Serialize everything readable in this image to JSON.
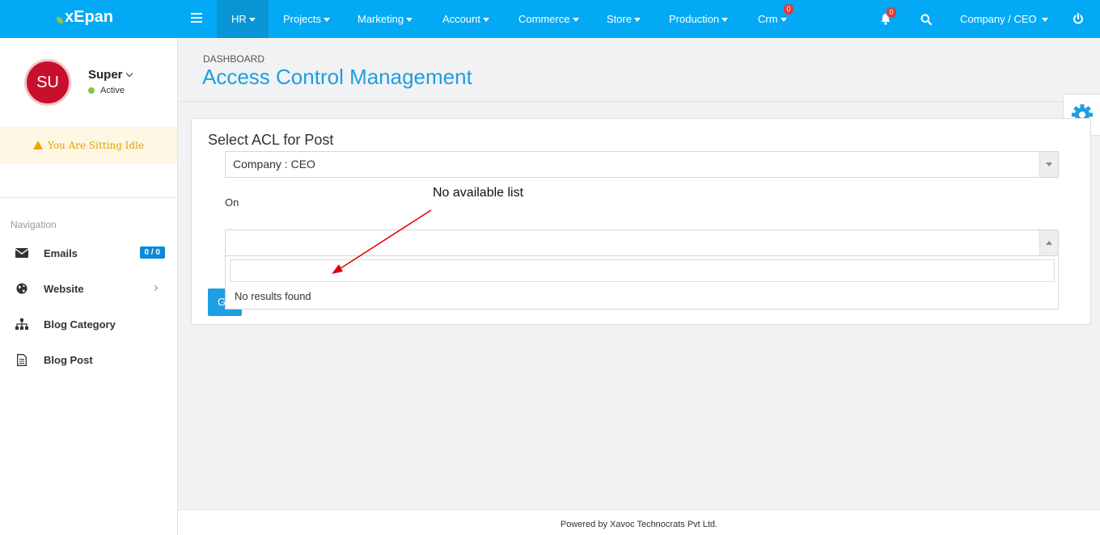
{
  "app": {
    "logo": "xEpan"
  },
  "topnav": {
    "items": [
      {
        "label": "HR"
      },
      {
        "label": "Projects"
      },
      {
        "label": "Marketing"
      },
      {
        "label": "Account"
      },
      {
        "label": "Commerce"
      },
      {
        "label": "Store"
      },
      {
        "label": "Production"
      },
      {
        "label": "Crm",
        "badge": "0"
      }
    ],
    "notifications_badge": "0",
    "user_menu": "Company / CEO"
  },
  "sidebar": {
    "avatar_initials": "SU",
    "user_name": "Super",
    "user_status": "Active",
    "idle_message": "You Are Sitting Idle",
    "nav_heading": "Navigation",
    "items": [
      {
        "label": "Emails",
        "icon": "envelope-icon",
        "count": "0 / 0"
      },
      {
        "label": "Website",
        "icon": "globe-icon"
      },
      {
        "label": "Blog Category",
        "icon": "sitemap-icon"
      },
      {
        "label": "Blog Post",
        "icon": "file-icon"
      }
    ]
  },
  "header": {
    "breadcrumb": "DASHBOARD",
    "title": "Access Control Management"
  },
  "form": {
    "title": "Select ACL for Post",
    "post_select_value": "Company : CEO",
    "on_label": "On",
    "on_select_value": "",
    "dropdown_search_value": "",
    "no_results": "No results found",
    "go_button": "G"
  },
  "annotation": {
    "text": "No available list"
  },
  "footer": {
    "text": "Powered by Xavoc Technocrats Pvt Ltd."
  },
  "colors": {
    "primary": "#03a9f4",
    "title": "#1e9ee3",
    "avatar": "#c8102e",
    "badge": "#e53935",
    "annotation_arrow": "#e00000"
  }
}
